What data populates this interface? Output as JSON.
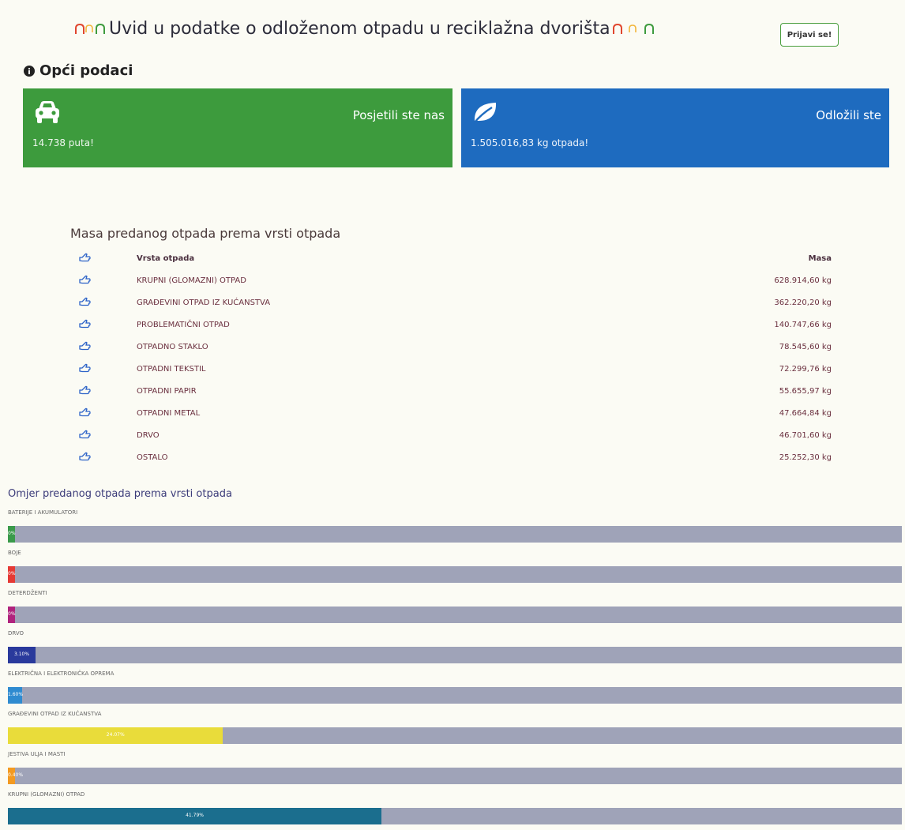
{
  "header": {
    "title": "Uvid u podatke o odloženom otpadu u reciklažna dvorišta",
    "login_label": "Prijavi se!"
  },
  "general": {
    "heading": "Opći podaci",
    "visits": {
      "title": "Posjetili ste nas",
      "value": "14.738 puta!",
      "icon": "car-icon",
      "color": "#3d9b3d"
    },
    "deposited": {
      "title": "Odložili ste",
      "value": "1.505.016,83 kg otpada!",
      "icon": "leaf-icon",
      "color": "#1e6bbf"
    }
  },
  "mass_table": {
    "heading": "Masa predanog otpada prema vrsti otpada",
    "icon": "pointing-hand-icon",
    "columns": {
      "type": "Vrsta otpada",
      "mass": "Masa"
    },
    "rows": [
      {
        "type": "KRUPNI (GLOMAZNI) OTPAD",
        "mass": "628.914,60 kg"
      },
      {
        "type": "GRAĐEVINI OTPAD IZ KUĆANSTVA",
        "mass": "362.220,20 kg"
      },
      {
        "type": "PROBLEMATIČNI OTPAD",
        "mass": "140.747,66 kg"
      },
      {
        "type": "OTPADNO STAKLO",
        "mass": "78.545,60 kg"
      },
      {
        "type": "OTPADNI TEKSTIL",
        "mass": "72.299,76 kg"
      },
      {
        "type": "OTPADNI PAPIR",
        "mass": "55.655,97 kg"
      },
      {
        "type": "OTPADNI METAL",
        "mass": "47.664,84 kg"
      },
      {
        "type": "DRVO",
        "mass": "46.701,60 kg"
      },
      {
        "type": "OSTALO",
        "mass": "25.252,30 kg"
      }
    ]
  },
  "ratio": {
    "heading": "Omjer predanog otpada prema vrsti otpada",
    "items": [
      {
        "label": "BATERIJE I AKUMULATORI",
        "percent": 0.8,
        "display": "0%",
        "color": "#3a9a4a"
      },
      {
        "label": "BOJE",
        "percent": 0.8,
        "display": "0%",
        "color": "#e53a35"
      },
      {
        "label": "DETERDŽENTI",
        "percent": 0.8,
        "display": "0%",
        "color": "#b0237d"
      },
      {
        "label": "DRVO",
        "percent": 3.1,
        "display": "3.10%",
        "color": "#2a3a9c"
      },
      {
        "label": "ELEKTRIČNA I ELEKTRONIČKA OPREMA",
        "percent": 1.6,
        "display": "1.60%",
        "color": "#2f8bd0"
      },
      {
        "label": "GRAĐEVINI OTPAD IZ KUĆANSTVA",
        "percent": 24.07,
        "display": "24.07%",
        "color": "#e9dc3a"
      },
      {
        "label": "JESTIVA ULJA I MASTI",
        "percent": 0.8,
        "display": "0.40%",
        "color": "#f39a21"
      },
      {
        "label": "KRUPNI (GLOMAZNI) OTPAD",
        "percent": 41.79,
        "display": "41.79%",
        "color": "#1b6e8e"
      }
    ]
  }
}
